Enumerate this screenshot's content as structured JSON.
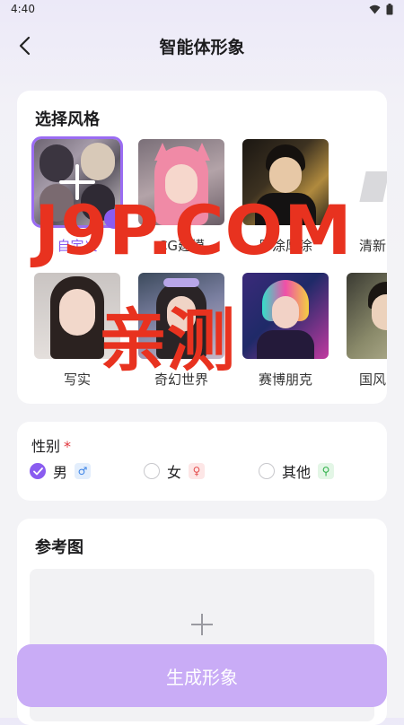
{
  "status_bar": {
    "time": "4:40"
  },
  "header": {
    "title": "智能体形象"
  },
  "style_section": {
    "title": "选择风格",
    "styles": [
      {
        "label": "自定义",
        "selected": true
      },
      {
        "label": "CG建模"
      },
      {
        "label": "厚涂厚涂"
      },
      {
        "label": "清新"
      },
      {
        "label": "写实"
      },
      {
        "label": "奇幻世界"
      },
      {
        "label": "赛博朋克"
      },
      {
        "label": "国风"
      }
    ]
  },
  "gender": {
    "title": "性别",
    "required_mark": "*",
    "options": [
      {
        "label": "男",
        "icon": "male-icon",
        "selected": true
      },
      {
        "label": "女",
        "icon": "female-icon"
      },
      {
        "label": "其他",
        "icon": "other-gender-icon"
      }
    ]
  },
  "reference": {
    "title": "参考图"
  },
  "generate_button": {
    "label": "生成形象"
  },
  "watermark": {
    "line1": "J9P.COM",
    "line2": "亲测"
  },
  "colors": {
    "accent": "#8a5cf0",
    "button": "#c9acf6",
    "required": "#e0343b"
  }
}
